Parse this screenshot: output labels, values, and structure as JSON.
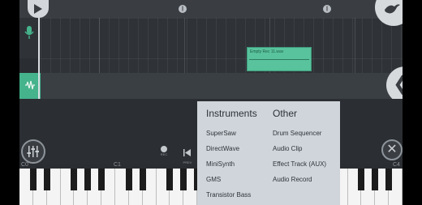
{
  "clip": {
    "label": "Empty Rec 11.wav"
  },
  "timeline": {
    "markers": [
      "||",
      "||"
    ]
  },
  "piano": {
    "octaves": [
      "C0",
      "C1",
      "C4"
    ]
  },
  "controls": {
    "rec_label": "REC",
    "prev_label": "PREV"
  },
  "menu": {
    "instruments_header": "Instruments",
    "other_header": "Other",
    "instruments": [
      "SuperSaw",
      "DirectWave",
      "MiniSynth",
      "GMS",
      "Transistor Bass"
    ],
    "other": [
      "Drum Sequencer",
      "Audio Clip",
      "Effect Track (AUX)",
      "Audio Record"
    ]
  },
  "colors": {
    "track_green": "#45b38c",
    "clip_green": "#58c39d",
    "menu_bg": "#cfd5da"
  }
}
